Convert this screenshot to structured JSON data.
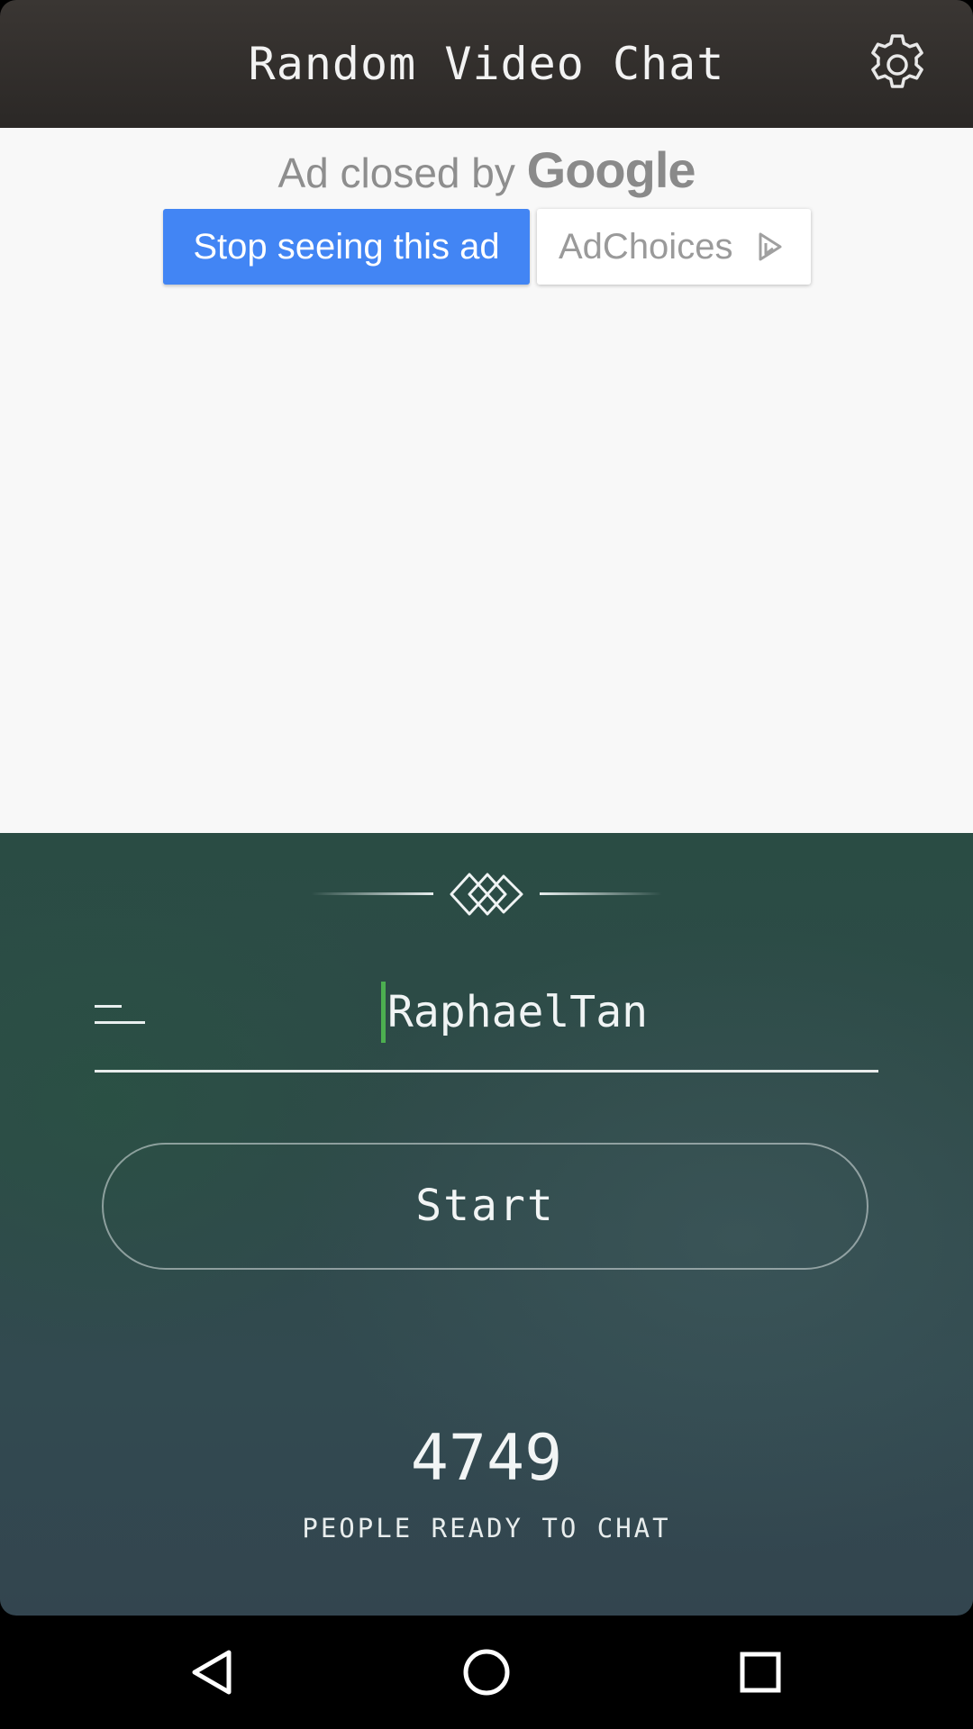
{
  "app_bar": {
    "title": "Random Video Chat",
    "settings_icon": "gear-icon"
  },
  "ad": {
    "closed_text": "Ad closed by",
    "brand": "Google",
    "stop_button": "Stop seeing this ad",
    "adchoices_button": "AdChoices",
    "adchoices_icon": "adchoices-icon"
  },
  "main": {
    "logo_icon": "diamond-logo-icon",
    "menu_icon": "menu-icon",
    "username": "RaphaelTan",
    "start_button": "Start",
    "online_count": "4749",
    "online_label": "PEOPLE READY TO CHAT"
  },
  "navbar": {
    "back_icon": "back-triangle-icon",
    "home_icon": "home-circle-icon",
    "recents_icon": "recents-square-icon"
  },
  "colors": {
    "accent_blue": "#4285f4",
    "cursor_green": "#4caf50",
    "appbar": "#2f2c2a",
    "panel": "#2e4a48"
  }
}
